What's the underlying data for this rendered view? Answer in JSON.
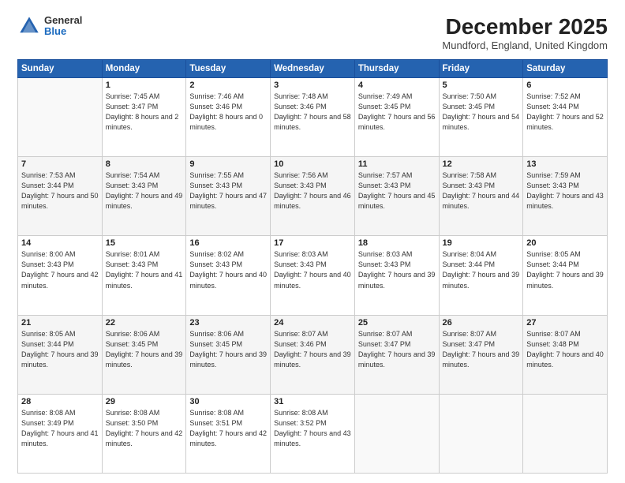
{
  "header": {
    "logo_general": "General",
    "logo_blue": "Blue",
    "month_title": "December 2025",
    "location": "Mundford, England, United Kingdom"
  },
  "days_of_week": [
    "Sunday",
    "Monday",
    "Tuesday",
    "Wednesday",
    "Thursday",
    "Friday",
    "Saturday"
  ],
  "weeks": [
    [
      {
        "day": "",
        "empty": true
      },
      {
        "day": "1",
        "sunrise": "Sunrise: 7:45 AM",
        "sunset": "Sunset: 3:47 PM",
        "daylight": "Daylight: 8 hours and 2 minutes."
      },
      {
        "day": "2",
        "sunrise": "Sunrise: 7:46 AM",
        "sunset": "Sunset: 3:46 PM",
        "daylight": "Daylight: 8 hours and 0 minutes."
      },
      {
        "day": "3",
        "sunrise": "Sunrise: 7:48 AM",
        "sunset": "Sunset: 3:46 PM",
        "daylight": "Daylight: 7 hours and 58 minutes."
      },
      {
        "day": "4",
        "sunrise": "Sunrise: 7:49 AM",
        "sunset": "Sunset: 3:45 PM",
        "daylight": "Daylight: 7 hours and 56 minutes."
      },
      {
        "day": "5",
        "sunrise": "Sunrise: 7:50 AM",
        "sunset": "Sunset: 3:45 PM",
        "daylight": "Daylight: 7 hours and 54 minutes."
      },
      {
        "day": "6",
        "sunrise": "Sunrise: 7:52 AM",
        "sunset": "Sunset: 3:44 PM",
        "daylight": "Daylight: 7 hours and 52 minutes."
      }
    ],
    [
      {
        "day": "7",
        "sunrise": "Sunrise: 7:53 AM",
        "sunset": "Sunset: 3:44 PM",
        "daylight": "Daylight: 7 hours and 50 minutes."
      },
      {
        "day": "8",
        "sunrise": "Sunrise: 7:54 AM",
        "sunset": "Sunset: 3:43 PM",
        "daylight": "Daylight: 7 hours and 49 minutes."
      },
      {
        "day": "9",
        "sunrise": "Sunrise: 7:55 AM",
        "sunset": "Sunset: 3:43 PM",
        "daylight": "Daylight: 7 hours and 47 minutes."
      },
      {
        "day": "10",
        "sunrise": "Sunrise: 7:56 AM",
        "sunset": "Sunset: 3:43 PM",
        "daylight": "Daylight: 7 hours and 46 minutes."
      },
      {
        "day": "11",
        "sunrise": "Sunrise: 7:57 AM",
        "sunset": "Sunset: 3:43 PM",
        "daylight": "Daylight: 7 hours and 45 minutes."
      },
      {
        "day": "12",
        "sunrise": "Sunrise: 7:58 AM",
        "sunset": "Sunset: 3:43 PM",
        "daylight": "Daylight: 7 hours and 44 minutes."
      },
      {
        "day": "13",
        "sunrise": "Sunrise: 7:59 AM",
        "sunset": "Sunset: 3:43 PM",
        "daylight": "Daylight: 7 hours and 43 minutes."
      }
    ],
    [
      {
        "day": "14",
        "sunrise": "Sunrise: 8:00 AM",
        "sunset": "Sunset: 3:43 PM",
        "daylight": "Daylight: 7 hours and 42 minutes."
      },
      {
        "day": "15",
        "sunrise": "Sunrise: 8:01 AM",
        "sunset": "Sunset: 3:43 PM",
        "daylight": "Daylight: 7 hours and 41 minutes."
      },
      {
        "day": "16",
        "sunrise": "Sunrise: 8:02 AM",
        "sunset": "Sunset: 3:43 PM",
        "daylight": "Daylight: 7 hours and 40 minutes."
      },
      {
        "day": "17",
        "sunrise": "Sunrise: 8:03 AM",
        "sunset": "Sunset: 3:43 PM",
        "daylight": "Daylight: 7 hours and 40 minutes."
      },
      {
        "day": "18",
        "sunrise": "Sunrise: 8:03 AM",
        "sunset": "Sunset: 3:43 PM",
        "daylight": "Daylight: 7 hours and 39 minutes."
      },
      {
        "day": "19",
        "sunrise": "Sunrise: 8:04 AM",
        "sunset": "Sunset: 3:44 PM",
        "daylight": "Daylight: 7 hours and 39 minutes."
      },
      {
        "day": "20",
        "sunrise": "Sunrise: 8:05 AM",
        "sunset": "Sunset: 3:44 PM",
        "daylight": "Daylight: 7 hours and 39 minutes."
      }
    ],
    [
      {
        "day": "21",
        "sunrise": "Sunrise: 8:05 AM",
        "sunset": "Sunset: 3:44 PM",
        "daylight": "Daylight: 7 hours and 39 minutes."
      },
      {
        "day": "22",
        "sunrise": "Sunrise: 8:06 AM",
        "sunset": "Sunset: 3:45 PM",
        "daylight": "Daylight: 7 hours and 39 minutes."
      },
      {
        "day": "23",
        "sunrise": "Sunrise: 8:06 AM",
        "sunset": "Sunset: 3:45 PM",
        "daylight": "Daylight: 7 hours and 39 minutes."
      },
      {
        "day": "24",
        "sunrise": "Sunrise: 8:07 AM",
        "sunset": "Sunset: 3:46 PM",
        "daylight": "Daylight: 7 hours and 39 minutes."
      },
      {
        "day": "25",
        "sunrise": "Sunrise: 8:07 AM",
        "sunset": "Sunset: 3:47 PM",
        "daylight": "Daylight: 7 hours and 39 minutes."
      },
      {
        "day": "26",
        "sunrise": "Sunrise: 8:07 AM",
        "sunset": "Sunset: 3:47 PM",
        "daylight": "Daylight: 7 hours and 39 minutes."
      },
      {
        "day": "27",
        "sunrise": "Sunrise: 8:07 AM",
        "sunset": "Sunset: 3:48 PM",
        "daylight": "Daylight: 7 hours and 40 minutes."
      }
    ],
    [
      {
        "day": "28",
        "sunrise": "Sunrise: 8:08 AM",
        "sunset": "Sunset: 3:49 PM",
        "daylight": "Daylight: 7 hours and 41 minutes."
      },
      {
        "day": "29",
        "sunrise": "Sunrise: 8:08 AM",
        "sunset": "Sunset: 3:50 PM",
        "daylight": "Daylight: 7 hours and 42 minutes."
      },
      {
        "day": "30",
        "sunrise": "Sunrise: 8:08 AM",
        "sunset": "Sunset: 3:51 PM",
        "daylight": "Daylight: 7 hours and 42 minutes."
      },
      {
        "day": "31",
        "sunrise": "Sunrise: 8:08 AM",
        "sunset": "Sunset: 3:52 PM",
        "daylight": "Daylight: 7 hours and 43 minutes."
      },
      {
        "day": "",
        "empty": true
      },
      {
        "day": "",
        "empty": true
      },
      {
        "day": "",
        "empty": true
      }
    ]
  ]
}
